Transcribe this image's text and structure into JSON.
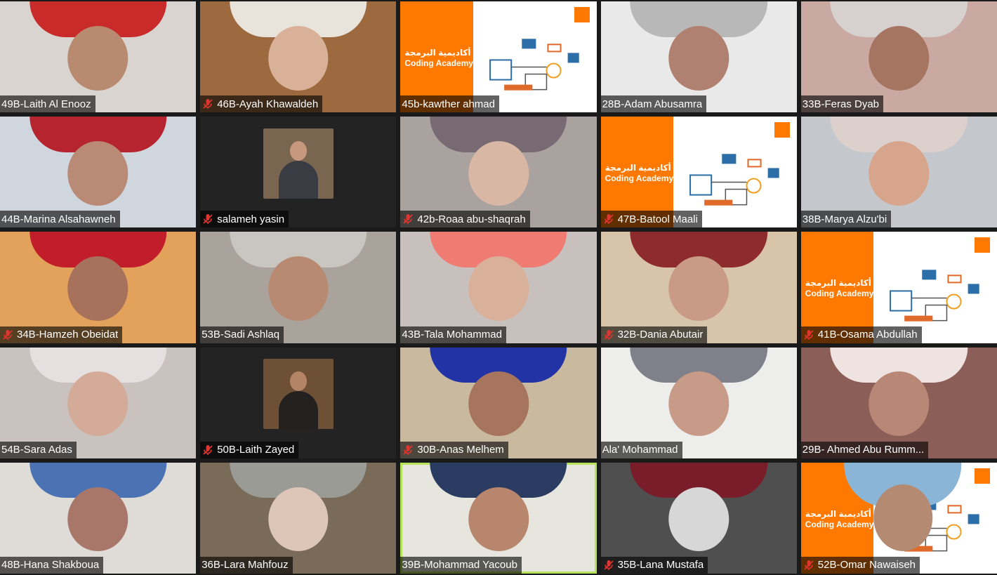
{
  "colors": {
    "active_speaker_border": "#b7e35a",
    "mute_icon": "#e0342f",
    "orange_brand": "#ff7900",
    "nameplate_bg": "rgba(0,0,0,0.62)"
  },
  "participants": [
    {
      "name": "49B-Laith Al Enooz",
      "muted": false,
      "bg": "#d9d4cf",
      "style": "person",
      "shirt": "#c92a2a",
      "skin": "#b88a6f"
    },
    {
      "name": "46B-Ayah Khawaldeh",
      "muted": true,
      "bg": "#9c6a3e",
      "style": "person",
      "shirt": "#e9e4db",
      "skin": "#d8b198"
    },
    {
      "name": "45b-kawther ahmad",
      "muted": false,
      "bg": "#ffffff",
      "style": "slide"
    },
    {
      "name": "28B-Adam Abusamra",
      "muted": false,
      "bg": "#e9e9e9",
      "style": "person",
      "shirt": "#b8b8b8",
      "skin": "#b08070"
    },
    {
      "name": "33B-Feras Dyab",
      "muted": false,
      "bg": "#c9a9a1",
      "style": "person",
      "shirt": "#d6d0ce",
      "skin": "#a57561"
    },
    {
      "name": "44B-Marina Alsahawneh",
      "muted": false,
      "bg": "#cfd6de",
      "style": "person",
      "shirt": "#b5242f",
      "skin": "#b98a76"
    },
    {
      "name": "salameh yasin",
      "muted": true,
      "bg": "#232323",
      "style": "thumb",
      "thumb_bg": "#7a6650",
      "shirt": "#3a3c44",
      "skin": "#c7987e"
    },
    {
      "name": "42b-Roaa abu-shaqrah",
      "muted": true,
      "bg": "#a9a29f",
      "style": "person",
      "shirt": "#776a72",
      "skin": "#d9b7a5"
    },
    {
      "name": "47B-Batool Maali",
      "muted": true,
      "bg": "#ffffff",
      "style": "slide"
    },
    {
      "name": "38B-Marya Alzu'bi",
      "muted": false,
      "bg": "#c4c8cc",
      "style": "person",
      "shirt": "#dcd0cc",
      "skin": "#d6a58c"
    },
    {
      "name": "34B-Hamzeh Obeidat",
      "muted": true,
      "bg": "#e3a25c",
      "style": "person",
      "shirt": "#c21d2a",
      "skin": "#a7725c"
    },
    {
      "name": "53B-Sadi Ashlaq",
      "muted": false,
      "bg": "#a9a39c",
      "style": "person",
      "shirt": "#c9c6c2",
      "skin": "#b88a72"
    },
    {
      "name": "43B-Tala Mohammad",
      "muted": false,
      "bg": "#c7c0bc",
      "style": "person",
      "shirt": "#f07b73",
      "skin": "#d9b09a"
    },
    {
      "name": "32B-Dania Abutair",
      "muted": true,
      "bg": "#d8c4a8",
      "style": "person",
      "shirt": "#8e2b2e",
      "skin": "#c99b86"
    },
    {
      "name": "41B-Osama Abdullah",
      "muted": true,
      "bg": "#ffffff",
      "style": "slide"
    },
    {
      "name": "54B-Sara Adas",
      "muted": false,
      "bg": "#c9c2bf",
      "style": "person",
      "shirt": "#e5dfdf",
      "skin": "#d3ab98"
    },
    {
      "name": "50B-Laith Zayed",
      "muted": true,
      "bg": "#232323",
      "style": "thumb",
      "thumb_bg": "#6e5037",
      "shirt": "#232020",
      "skin": "#b48467"
    },
    {
      "name": "30B-Anas Melhem",
      "muted": true,
      "bg": "#c9b99e",
      "style": "person",
      "shirt": "#2233a6",
      "skin": "#a7745e"
    },
    {
      "name": "Ala' Mohammad",
      "muted": false,
      "bg": "#ededeb",
      "style": "person",
      "shirt": "#7f8089",
      "skin": "#c79b88"
    },
    {
      "name": "29B- Ahmed Abu Rumm...",
      "muted": false,
      "bg": "#8b5f57",
      "style": "person",
      "shirt": "#efe3e1",
      "skin": "#b98775"
    },
    {
      "name": "48B-Hana Shakboua",
      "muted": false,
      "bg": "#dfdbd7",
      "style": "person",
      "shirt": "#4b73b3",
      "skin": "#a9776a"
    },
    {
      "name": "36B-Lara Mahfouz",
      "muted": false,
      "bg": "#7a6b58",
      "style": "person",
      "shirt": "#9b9b95",
      "skin": "#ddc5b8"
    },
    {
      "name": "39B-Mohammad Yacoub",
      "muted": false,
      "bg": "#e6e6df",
      "style": "person",
      "shirt": "#2b3c63",
      "skin": "#b8866c",
      "active": true
    },
    {
      "name": "35B-Lana Mustafa",
      "muted": true,
      "bg": "#4f4f4f",
      "style": "person",
      "shirt": "#7a1d2b",
      "skin": "#d7d7d7"
    },
    {
      "name": "52B-Omar Nawaiseh",
      "muted": true,
      "bg": "#ffffff",
      "style": "slide",
      "overlay_person": true
    }
  ],
  "slide": {
    "arabic_title": "أكاديمية البرمجة",
    "english_title": "Coding Academy",
    "logo_text": "orange"
  },
  "icons": {
    "muted": "mic-off-icon",
    "logo": "orange-logo-icon"
  }
}
